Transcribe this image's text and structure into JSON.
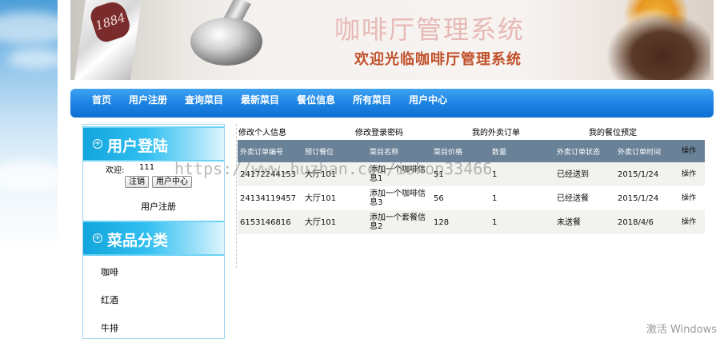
{
  "banner": {
    "title_big": "咖啡厅管理系统",
    "title_small": "欢迎光临咖啡厅管理系统",
    "pack_logo": "1884"
  },
  "nav": {
    "items": [
      "首页",
      "用户注册",
      "查询菜目",
      "最新菜目",
      "餐位信息",
      "所有菜目",
      "用户中心"
    ]
  },
  "sidebar": {
    "login_title": "用户登陆",
    "welcome_label": "欢迎:",
    "username": "111",
    "logout_button": "注销",
    "user_center_button": "用户中心",
    "register_link": "用户注册",
    "category_title": "菜品分类",
    "categories": [
      "咖啡",
      "红酒",
      "牛排"
    ]
  },
  "main": {
    "sublinks": [
      "修改个人信息",
      "修改登录密码",
      "我的外卖订单",
      "我的餐位预定"
    ],
    "headers": [
      "外卖订单编号",
      "预订餐位",
      "菜目名称",
      "菜目价格",
      "数量",
      "外卖订单状态",
      "外卖订单时间",
      "操作"
    ],
    "rows": [
      [
        "24172244153",
        "大厅101",
        "添加一个咖啡信息1",
        "51",
        "1",
        "已经送到",
        "2015/1/24",
        "操作"
      ],
      [
        "24134119457",
        "大厅101",
        "添加一个咖啡信息3",
        "56",
        "1",
        "已经送餐",
        "2015/1/24",
        "操作"
      ],
      [
        "6153146816",
        "大厅101",
        "添加一个套餐信息2",
        "128",
        "1",
        "未送餐",
        "2018/4/6",
        "操作"
      ]
    ]
  },
  "watermark": "https://www.huzhan.com/ishop33466",
  "os_notice": "激活 Windows",
  "colors": {
    "nav_blue": "#1e86e6",
    "table_header": "#6a8298",
    "sidebar_head": "#32bff0",
    "title_red": "#c0502a"
  }
}
